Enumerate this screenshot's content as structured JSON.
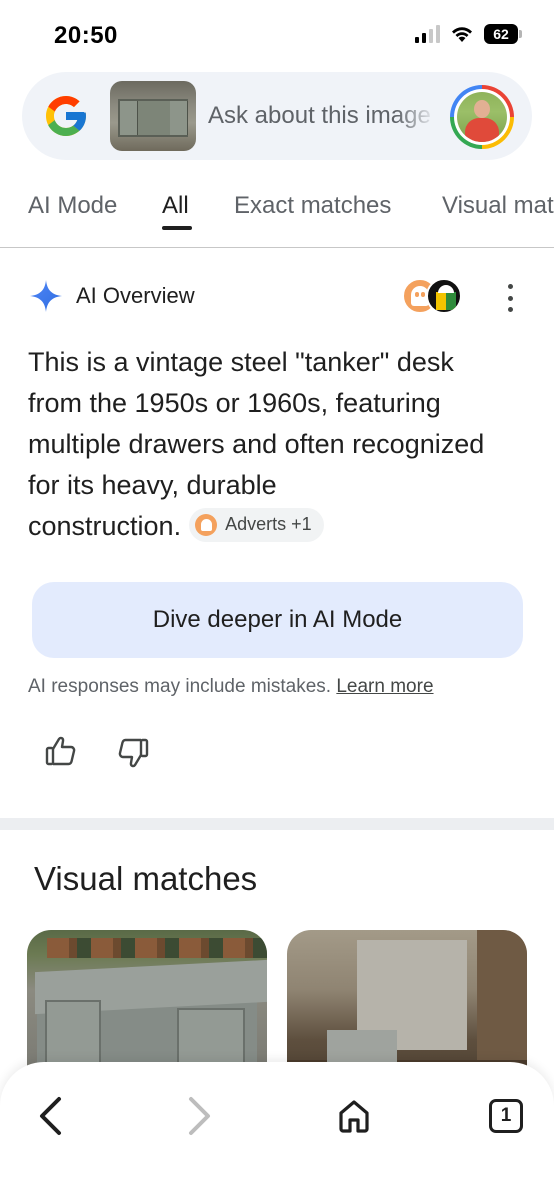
{
  "status_bar": {
    "time": "20:50",
    "battery": "62"
  },
  "search": {
    "placeholder": "Ask about this image"
  },
  "tabs": [
    {
      "label": "AI Mode"
    },
    {
      "label": "All",
      "active": true
    },
    {
      "label": "Exact matches"
    },
    {
      "label": "Visual matches"
    }
  ],
  "ai_overview": {
    "title": "AI Overview",
    "body_lines": [
      "This is a vintage steel \"tanker\" desk",
      "from the 1950s or 1960s, featuring",
      "multiple drawers and often recognized",
      "for its heavy, durable",
      "construction."
    ],
    "source_chip": "Adverts +1",
    "dive_button": "Dive deeper in AI Mode",
    "disclaimer": "AI responses may include mistakes.",
    "learn_more": "Learn more"
  },
  "visual_matches": {
    "title": "Visual matches"
  },
  "bottom_nav": {
    "tab_count": "1"
  },
  "colors": {
    "accent": "#4285f4",
    "button_bg": "#e3ebfd",
    "search_bg": "#f0f3f8"
  }
}
